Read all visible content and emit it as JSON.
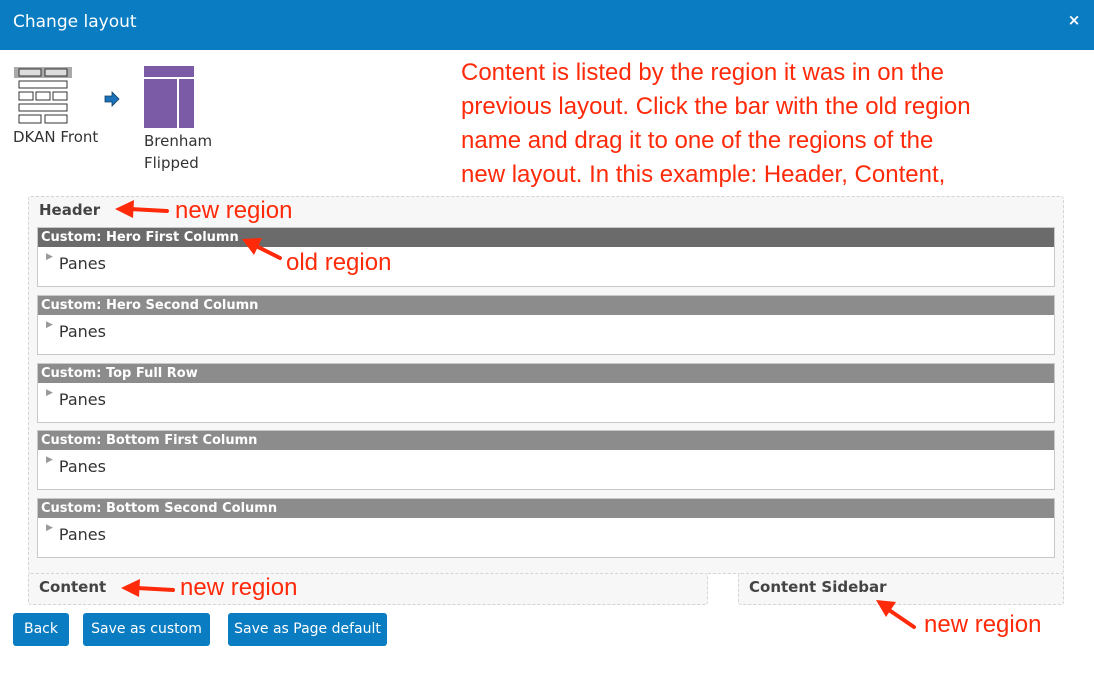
{
  "dialog": {
    "title": "Change layout",
    "close_glyph": "×"
  },
  "layouts": {
    "old_name": "DKAN Front",
    "new_name": "Brenham Flipped",
    "arrow_icon": "arrow-right-icon",
    "colors": {
      "new_layout": "#7b5ba6",
      "arrow": "#1c72b8"
    }
  },
  "annotation_text": "Content is listed by the region it was in on the previous layout. Click the bar with the old region name and drag it to one of the regions of the new layout. In this example: Header, Content, and Content Sidebar.",
  "regions": {
    "header": "Header",
    "content": "Content",
    "sidebar": "Content Sidebar"
  },
  "old_regions": [
    {
      "label": "Custom: Hero First Column",
      "panes": "Panes"
    },
    {
      "label": "Custom: Hero Second Column",
      "panes": "Panes"
    },
    {
      "label": "Custom: Top Full Row",
      "panes": "Panes"
    },
    {
      "label": "Custom: Bottom First Column",
      "panes": "Panes"
    },
    {
      "label": "Custom: Bottom Second Column",
      "panes": "Panes"
    }
  ],
  "annotations": {
    "new_region_1": "new region",
    "old_region": "old region",
    "new_region_2": "new region",
    "new_region_3": "new region"
  },
  "buttons": {
    "back": "Back",
    "save_custom": "Save as custom",
    "save_default": "Save as Page default"
  },
  "colors": {
    "accent": "#0a7dc2",
    "annotation": "#ff2a0a"
  }
}
